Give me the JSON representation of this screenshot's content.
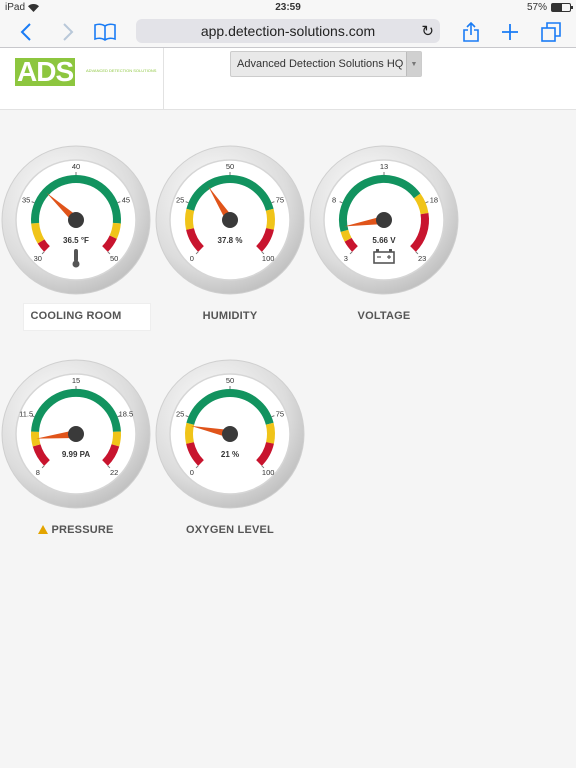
{
  "status_bar": {
    "device": "iPad",
    "time": "23:59",
    "battery": "57%",
    "battery_level": 0.57
  },
  "browser": {
    "url": "app.detection-solutions.com"
  },
  "app": {
    "logo_text": "ADS",
    "logo_tagline": "ADVANCED DETECTION SOLUTIONS",
    "site_selector": {
      "selected": "Advanced Detection Solutions HQ"
    }
  },
  "colors": {
    "green": "#12935f",
    "yellow": "#f0c419",
    "red": "#c8142e",
    "needle": "#e0541a",
    "accent": "#1a7cf5"
  },
  "gauges": [
    {
      "name": "COOLING ROOM",
      "min": 30,
      "max": 50,
      "ticks": [
        "30",
        "35",
        "40",
        "45",
        "50"
      ],
      "value": 36.5,
      "readout": "36.5 °F",
      "icon": "thermometer-icon",
      "warning": false,
      "zones": [
        [
          30,
          31,
          "red"
        ],
        [
          31,
          33,
          "yellow"
        ],
        [
          33,
          47,
          "green"
        ],
        [
          47,
          48.5,
          "yellow"
        ],
        [
          48.5,
          50,
          "red"
        ]
      ]
    },
    {
      "name": "HUMIDITY",
      "min": 0,
      "max": 100,
      "ticks": [
        "0",
        "25",
        "50",
        "75",
        "100"
      ],
      "value": 37.8,
      "readout": "37.8 %",
      "icon": "",
      "warning": false,
      "zones": [
        [
          0,
          12,
          "red"
        ],
        [
          12,
          22,
          "yellow"
        ],
        [
          22,
          78,
          "green"
        ],
        [
          78,
          88,
          "yellow"
        ],
        [
          88,
          100,
          "red"
        ]
      ]
    },
    {
      "name": "VOLTAGE",
      "min": 3,
      "max": 23,
      "ticks": [
        "3",
        "8",
        "13",
        "18",
        "23"
      ],
      "value": 5.66,
      "readout": "5.66 V",
      "icon": "battery-icon",
      "warning": false,
      "zones": [
        [
          3,
          4.2,
          "red"
        ],
        [
          4.2,
          5.2,
          "yellow"
        ],
        [
          5.2,
          17,
          "green"
        ],
        [
          17,
          19,
          "yellow"
        ],
        [
          19,
          23,
          "red"
        ]
      ]
    },
    {
      "name": "PRESSURE",
      "min": 8,
      "max": 22,
      "ticks": [
        "8",
        "11.5",
        "15",
        "18.5",
        "22"
      ],
      "value": 9.99,
      "readout": "9.99 PA",
      "icon": "",
      "warning": true,
      "zones": [
        [
          8,
          9.5,
          "red"
        ],
        [
          9.5,
          10.5,
          "yellow"
        ],
        [
          10.5,
          19.5,
          "green"
        ],
        [
          19.5,
          20.5,
          "yellow"
        ],
        [
          20.5,
          22,
          "red"
        ]
      ]
    },
    {
      "name": "OXYGEN LEVEL",
      "min": 0,
      "max": 100,
      "ticks": [
        "0",
        "25",
        "50",
        "75",
        "100"
      ],
      "value": 21,
      "readout": "21 %",
      "icon": "",
      "warning": false,
      "zones": [
        [
          0,
          12,
          "red"
        ],
        [
          12,
          22,
          "yellow"
        ],
        [
          22,
          78,
          "green"
        ],
        [
          78,
          88,
          "yellow"
        ],
        [
          88,
          100,
          "red"
        ]
      ]
    }
  ]
}
